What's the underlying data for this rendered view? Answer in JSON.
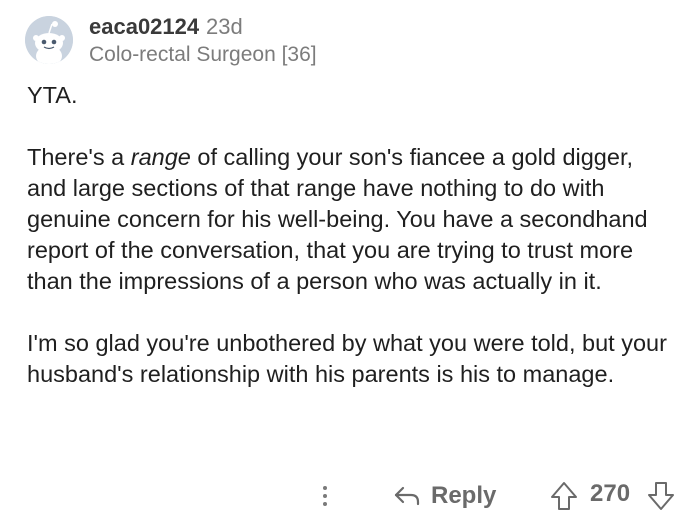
{
  "comment": {
    "username": "eaca02124",
    "age": "23d",
    "flair": "Colo-rectal Surgeon [36]",
    "paragraphs": {
      "p1": "YTA.",
      "p2_pre": "There's a ",
      "p2_em": "range",
      "p2_post": " of calling your son's fiancee a gold digger, and large sections of that range have nothing to do with genuine concern for his well-being. You have a secondhand report of the conversation, that you are trying to trust more than the impressions of a person who was actually in it.",
      "p3": "I'm so glad you're unbothered by what you were told, but your husband's relationship with his parents is his to manage."
    }
  },
  "actions": {
    "reply_label": "Reply",
    "score": "270"
  },
  "icons": {
    "avatar": "reddit-snoo-avatar",
    "more": "more-vertical-icon",
    "reply": "reply-arrow-icon",
    "upvote": "upvote-arrow-icon",
    "downvote": "downvote-arrow-icon"
  }
}
